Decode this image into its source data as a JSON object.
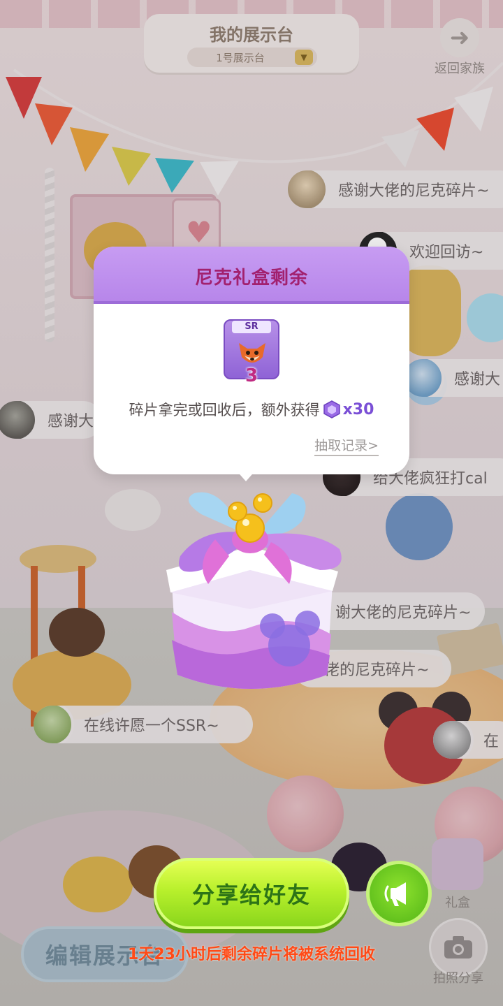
{
  "header": {
    "title": "我的展示台",
    "stand_select": "1号展示台",
    "back_label": "返回家族"
  },
  "bubbles": [
    {
      "text": "感谢大佬的尼克碎片~"
    },
    {
      "text": "欢迎回访~"
    },
    {
      "text": "感谢大"
    },
    {
      "text": "感谢大"
    },
    {
      "text": "给大佬疯狂打cal"
    },
    {
      "text": "谢大佬的尼克碎片~"
    },
    {
      "text": "大佬的尼克碎片~"
    },
    {
      "text": "在线许愿一个SSR~"
    },
    {
      "text": "在"
    }
  ],
  "popup": {
    "title": "尼克礼盒剩余",
    "card_rarity": "SR",
    "card_count": "3",
    "description": "碎片拿完或回收后，额外获得",
    "reward_count": "x30",
    "history_link": "抽取记录>"
  },
  "actions": {
    "share_label": "分享给好友",
    "recycle_notice": "1天23小时后剩余碎片将被系统回收",
    "edit_label": "编辑展示台",
    "giftbox_label": "礼盒",
    "photo_label": "拍照分享"
  },
  "icons": {
    "back": "arrow-right-icon",
    "audio": "megaphone-icon",
    "photo": "camera-icon",
    "gem": "purple-hexagon-gem-icon",
    "card": "fox-nick-card-icon"
  },
  "colors": {
    "popup_header": "#b786ea",
    "popup_title": "#a2216f",
    "share_button": "#b8f02c",
    "notice_text": "#ff4a17",
    "reward_text": "#7a4fd6"
  }
}
